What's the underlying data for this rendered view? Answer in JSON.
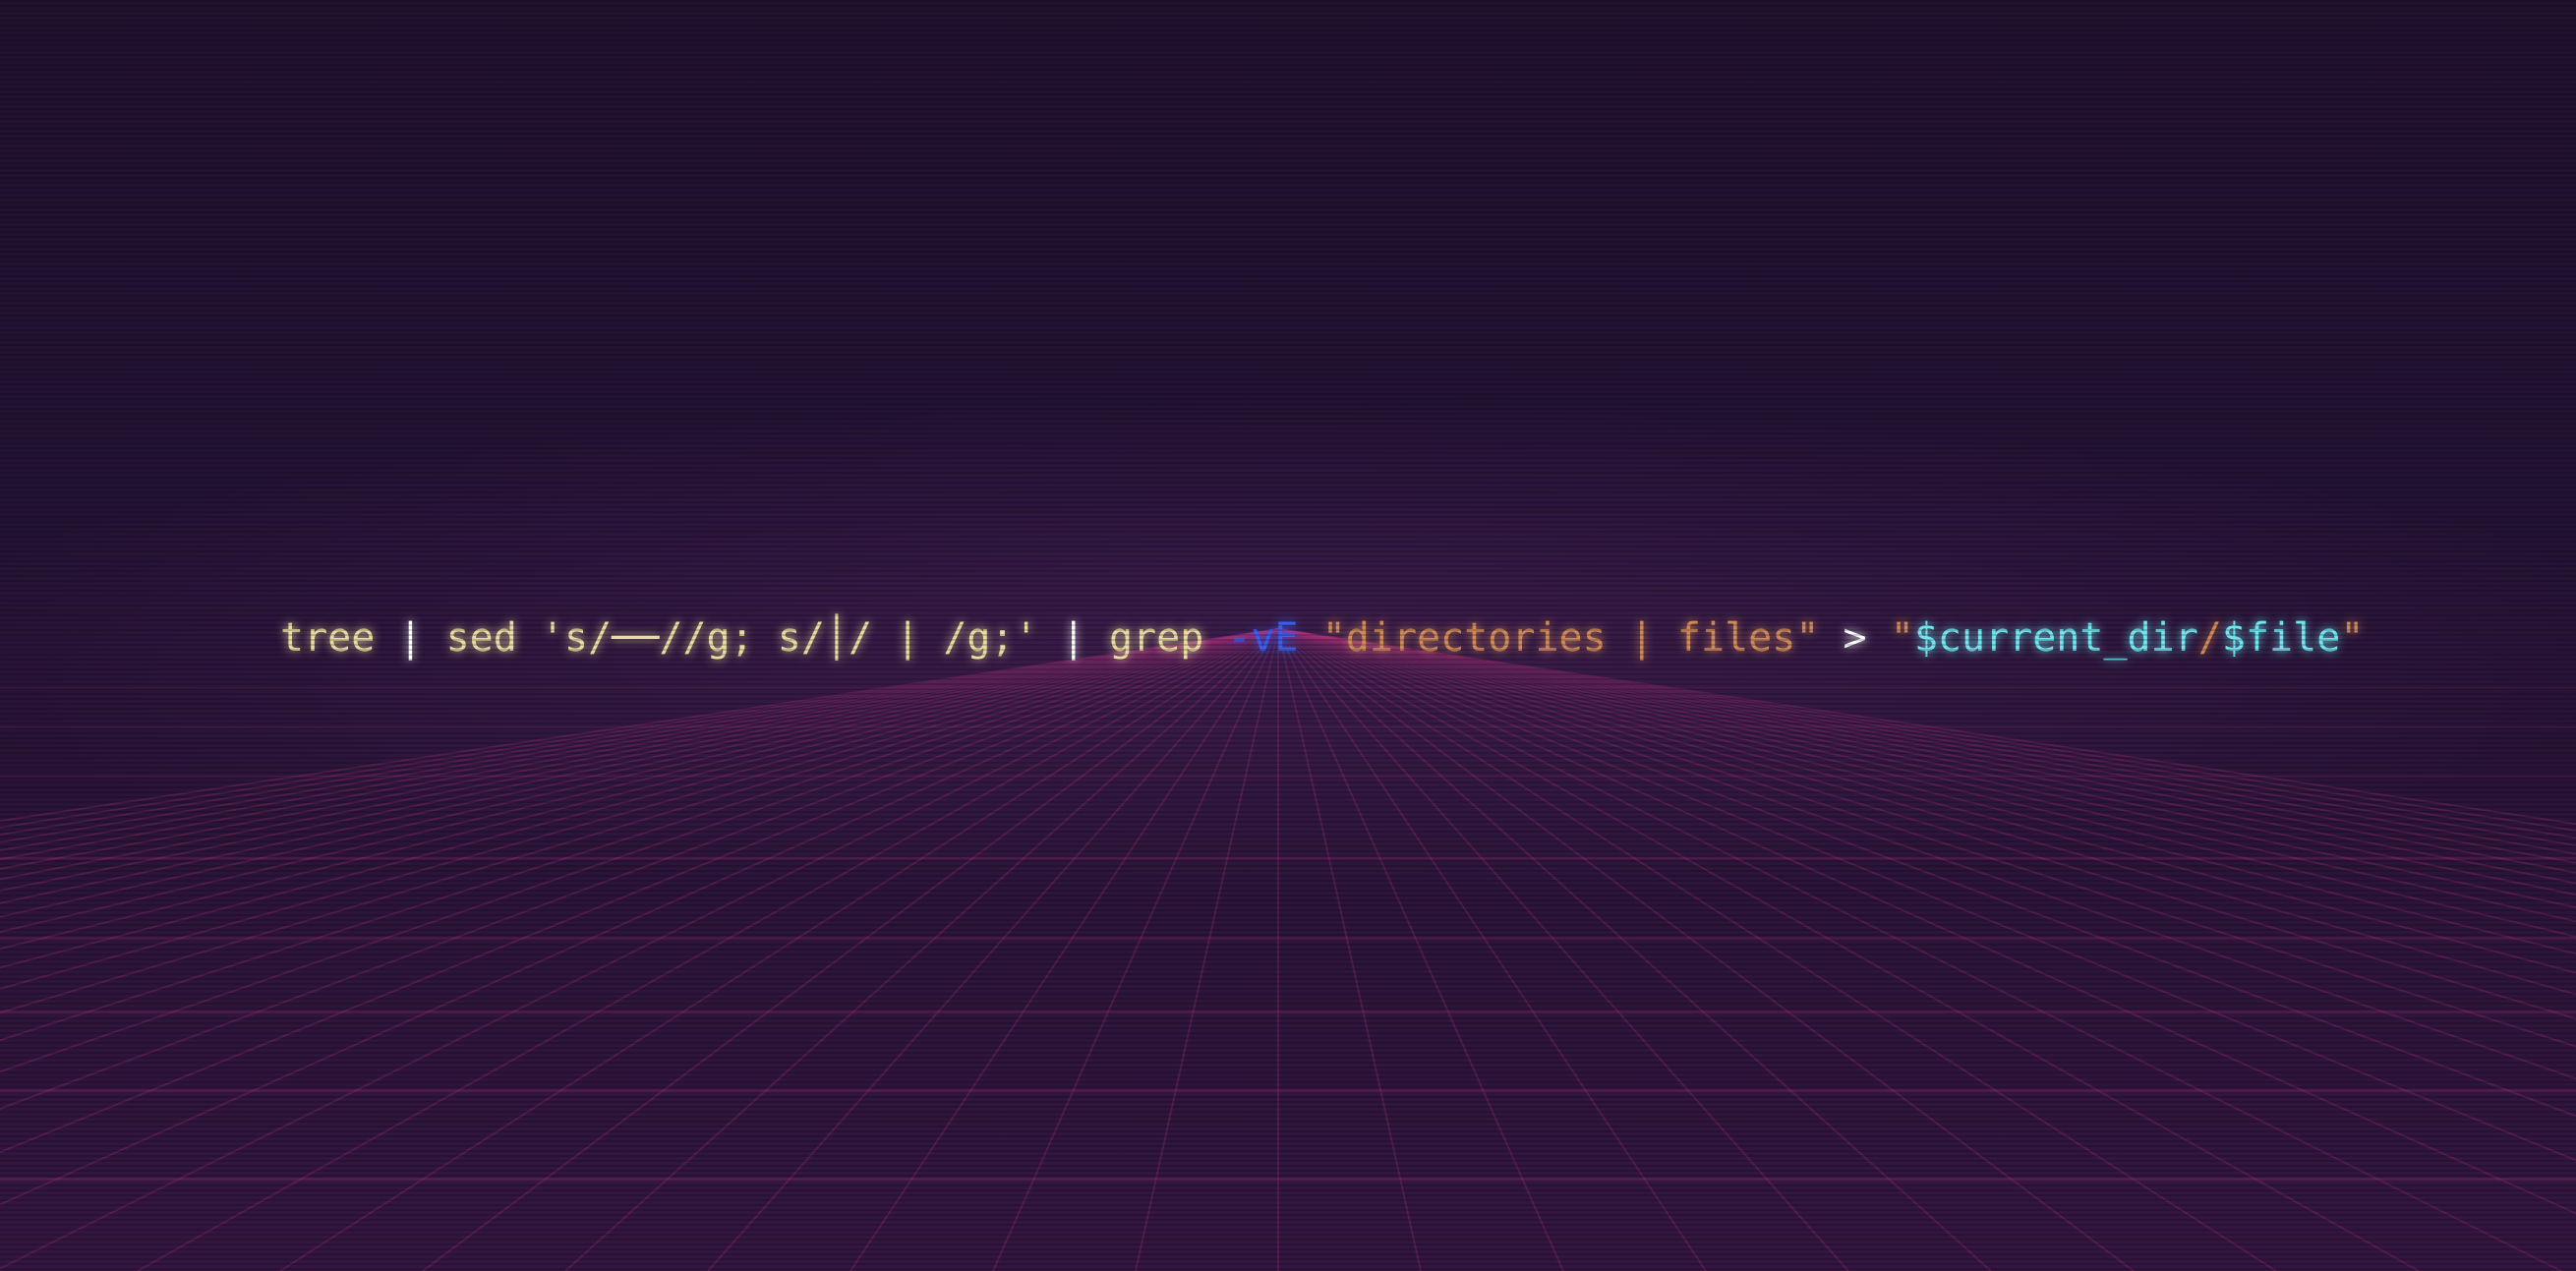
{
  "terminal": {
    "command_tokens": [
      {
        "text": "tree",
        "color": "#e9dca0"
      },
      {
        "text": " ",
        "color": "#e9dca0"
      },
      {
        "text": "|",
        "color": "#ffffff"
      },
      {
        "text": " sed ",
        "color": "#e9dca0"
      },
      {
        "text": "'s/──//g; s/│/ | /g;'",
        "color": "#e9dca0"
      },
      {
        "text": " ",
        "color": "#e9dca0"
      },
      {
        "text": "|",
        "color": "#ffffff"
      },
      {
        "text": " grep ",
        "color": "#e9dca0"
      },
      {
        "text": "-vE",
        "color": "#3a5ef0"
      },
      {
        "text": " ",
        "color": "#e9dca0"
      },
      {
        "text": "\"directories | files\"",
        "color": "#cf8a5a"
      },
      {
        "text": " ",
        "color": "#e9dca0"
      },
      {
        "text": ">",
        "color": "#ffffff"
      },
      {
        "text": " ",
        "color": "#e9dca0"
      },
      {
        "text": "\"",
        "color": "#cf8a5a"
      },
      {
        "text": "$current_dir",
        "color": "#72e6ef"
      },
      {
        "text": "/",
        "color": "#cf8a5a"
      },
      {
        "text": "$file",
        "color": "#72e6ef"
      },
      {
        "text": "\"",
        "color": "#cf8a5a"
      }
    ]
  },
  "theme": {
    "background": "#22112f",
    "grid_color": "#b0347e"
  }
}
